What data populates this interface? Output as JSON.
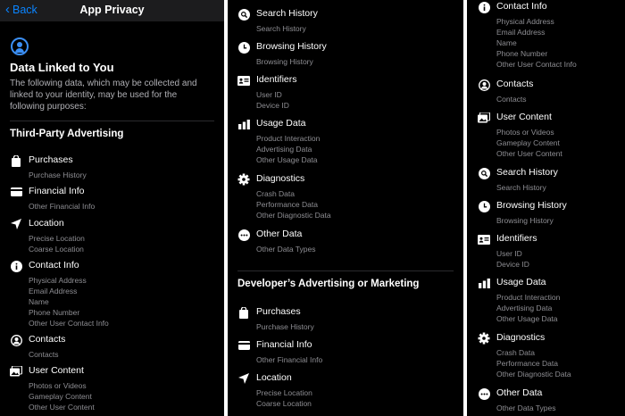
{
  "nav": {
    "back_label": "Back",
    "title": "App Privacy"
  },
  "section": {
    "heading": "Data Linked to You",
    "description": "The following data, which may be collected and linked to your identity, may be used for the following purposes:"
  },
  "purposes": {
    "third_party": "Third-Party Advertising",
    "developer": "Developer’s Advertising or Marketing"
  },
  "cats": {
    "purchases": {
      "icon": "bag-icon",
      "title": "Purchases",
      "items": [
        "Purchase History"
      ]
    },
    "financial": {
      "icon": "credit-card-icon",
      "title": "Financial Info",
      "items": [
        "Other Financial Info"
      ]
    },
    "location": {
      "icon": "location-arrow-icon",
      "title": "Location",
      "items": [
        "Precise Location",
        "Coarse Location"
      ]
    },
    "contact_info": {
      "icon": "info-circle-icon",
      "title": "Contact Info",
      "items": [
        "Physical Address",
        "Email Address",
        "Name",
        "Phone Number",
        "Other User Contact Info"
      ]
    },
    "contacts": {
      "icon": "person-circle-icon",
      "title": "Contacts",
      "items": [
        "Contacts"
      ]
    },
    "user_content": {
      "icon": "photo-icon",
      "title": "User Content",
      "items": [
        "Photos or Videos",
        "Gameplay Content",
        "Other User Content"
      ]
    },
    "search_history": {
      "icon": "magnifier-icon",
      "title": "Search History",
      "items": [
        "Search History"
      ]
    },
    "browsing_history": {
      "icon": "clock-icon",
      "title": "Browsing History",
      "items": [
        "Browsing History"
      ]
    },
    "identifiers": {
      "icon": "id-card-icon",
      "title": "Identifiers",
      "items": [
        "User ID",
        "Device ID"
      ]
    },
    "usage_data": {
      "icon": "bar-chart-icon",
      "title": "Usage Data",
      "items": [
        "Product Interaction",
        "Advertising Data",
        "Other Usage Data"
      ]
    },
    "diagnostics": {
      "icon": "gear-icon",
      "title": "Diagnostics",
      "items": [
        "Crash Data",
        "Performance Data",
        "Other Diagnostic Data"
      ]
    },
    "other_data": {
      "icon": "ellipsis-circle-icon",
      "title": "Other Data",
      "items": [
        "Other Data Types"
      ]
    }
  },
  "colors": {
    "accent": "#0a84ff",
    "background": "#000000",
    "secondary_text": "#8e8e93"
  }
}
